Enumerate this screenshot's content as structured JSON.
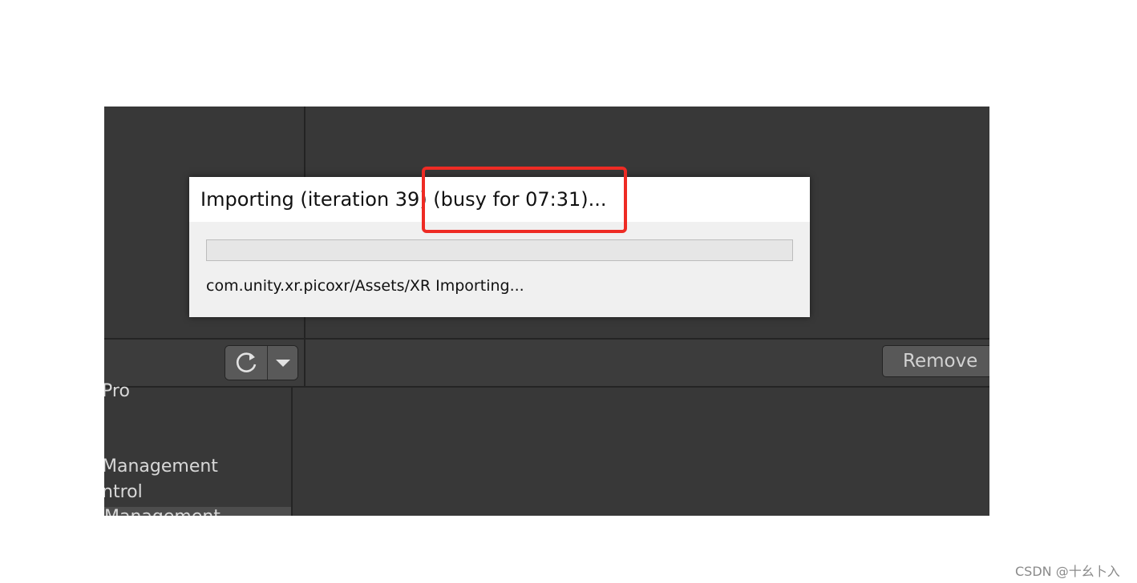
{
  "dialog": {
    "title": "Importing (iteration 39) (busy for 07:31)...",
    "status": "com.unity.xr.picoxr/Assets/XR Importing...",
    "progress": 0
  },
  "toolbar": {
    "refresh_icon": "refresh-icon",
    "dropdown_icon": "chevron-down-icon",
    "remove_label": "Remove"
  },
  "package_list": {
    "items": [
      {
        "label": "Pro"
      },
      {
        "label": "Management"
      },
      {
        "label": "ntrol"
      },
      {
        "label": "Management"
      }
    ]
  },
  "annotation": {
    "color": "#ee2b24"
  },
  "watermark": "CSDN @十幺卜入"
}
